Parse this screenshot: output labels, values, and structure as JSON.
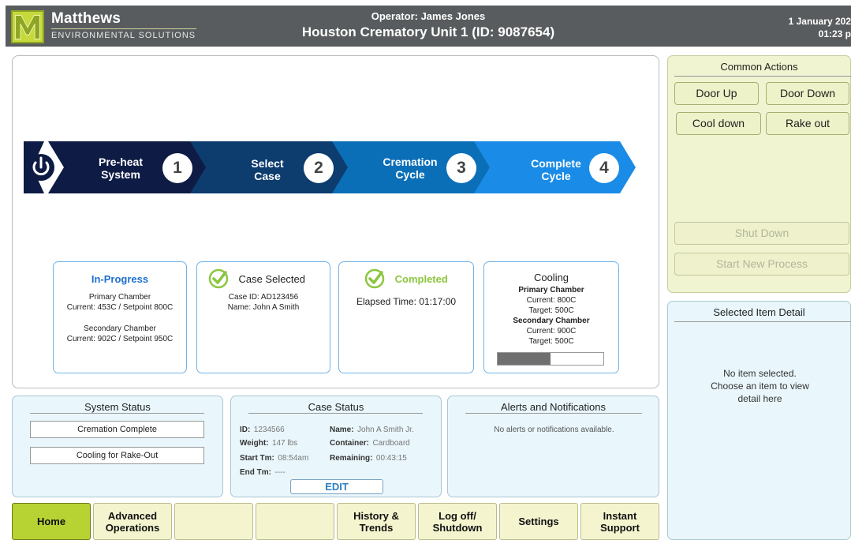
{
  "header": {
    "brand": "Matthews",
    "brand_sub": "ENVIRONMENTAL SOLUTIONS",
    "operator": "Operator: James Jones",
    "unit": "Houston Crematory Unit 1 (ID: 9087654)",
    "date": "1 January 202",
    "time": "01:23 p"
  },
  "steps": [
    {
      "title": "Pre-heat System",
      "num": "1",
      "color": "#0e1b44"
    },
    {
      "title": "Select Case",
      "num": "2",
      "color": "#0d3c6e"
    },
    {
      "title": "Cremation Cycle",
      "num": "3",
      "color": "#0b6fb8"
    },
    {
      "title": "Complete Cycle",
      "num": "4",
      "color": "#1a8be6"
    }
  ],
  "cards": {
    "preheat": {
      "status": "In-Progress",
      "primary_label": "Primary Chamber",
      "primary_value": "Current: 453C / Setpoint 800C",
      "secondary_label": "Secondary Chamber",
      "secondary_value": "Current: 902C / Setpoint 950C"
    },
    "select": {
      "status": "Case Selected",
      "case_id": "Case ID:  AD123456",
      "name": "Name:  John A Smith"
    },
    "cremation": {
      "status": "Completed",
      "elapsed": "Elapsed Time: 01:17:00"
    },
    "complete": {
      "status": "Cooling",
      "primary_label": "Primary Chamber",
      "primary_current": "Current:  800C",
      "primary_target": "Target: 500C",
      "secondary_label": "Secondary Chamber",
      "secondary_current": "Current:  900C",
      "secondary_target": "Target: 500C",
      "progress": 0.5
    }
  },
  "system_status": {
    "title": "System Status",
    "items": [
      "Cremation Complete",
      "Cooling for Rake-Out"
    ]
  },
  "case_status": {
    "title": "Case Status",
    "id_label": "ID:",
    "id": "1234566",
    "weight_label": "Weight:",
    "weight": "147 lbs",
    "start_label": "Start Tm:",
    "start": "08:54am",
    "end_label": "End Tm:",
    "end": "----",
    "name_label": "Name:",
    "name": "John A Smith Jr.",
    "container_label": "Container:",
    "container": "Cardboard",
    "remaining_label": "Remaining:",
    "remaining": "00:43:15",
    "edit": "EDIT"
  },
  "alerts": {
    "title": "Alerts and Notifications",
    "message": "No alerts or notifications available."
  },
  "common_actions": {
    "title": "Common Actions",
    "door_up": "Door Up",
    "door_down": "Door Down",
    "cool_down": "Cool down",
    "rake_out": "Rake out",
    "shut_down": "Shut Down",
    "start_new": "Start New Process"
  },
  "detail": {
    "title": "Selected Item Detail",
    "message_1": "No item selected.",
    "message_2": "Choose an item to view",
    "message_3": "detail here"
  },
  "nav": {
    "home": "Home",
    "advanced_1": "Advanced",
    "advanced_2": "Operations",
    "history_1": "History &",
    "history_2": "Trends",
    "logoff_1": "Log off/",
    "logoff_2": "Shutdown",
    "settings": "Settings",
    "support_1": "Instant",
    "support_2": "Support"
  },
  "colors": {
    "header_bg": "#595c5e",
    "brand_green": "#c6d93c",
    "check_green": "#8cc63f",
    "link_blue": "#2d7fc1"
  }
}
